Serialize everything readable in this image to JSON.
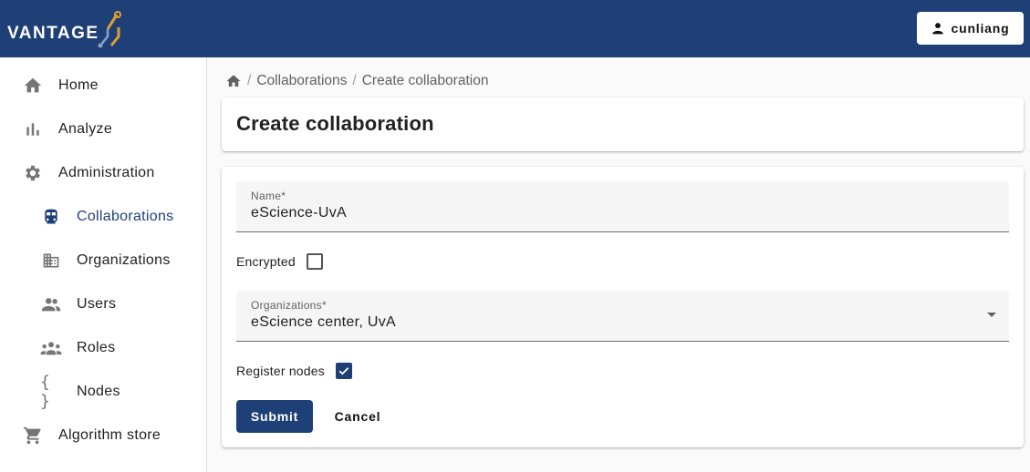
{
  "header": {
    "logo_text": "VANTAGE",
    "user_label": "cunliang",
    "brand_color": "#1e4077",
    "accent_color": "#e0a030"
  },
  "sidebar": {
    "items": [
      {
        "label": "Home",
        "icon": "home-icon"
      },
      {
        "label": "Analyze",
        "icon": "bar-chart-icon"
      },
      {
        "label": "Administration",
        "icon": "gear-icon"
      },
      {
        "label": "Collaborations",
        "icon": "train-icon",
        "active": true
      },
      {
        "label": "Organizations",
        "icon": "building-icon"
      },
      {
        "label": "Users",
        "icon": "people-icon"
      },
      {
        "label": "Roles",
        "icon": "groups-icon"
      },
      {
        "label": "Nodes",
        "icon": "braces-icon"
      },
      {
        "label": "Algorithm store",
        "icon": "cart-icon"
      }
    ]
  },
  "breadcrumb": {
    "items": [
      "Collaborations",
      "Create collaboration"
    ]
  },
  "page": {
    "title": "Create collaboration"
  },
  "form": {
    "name_label": "Name*",
    "name_value": "eScience-UvA",
    "encrypted_label": "Encrypted",
    "encrypted_checked": false,
    "organizations_label": "Organizations*",
    "organizations_value": "eScience center, UvA",
    "register_nodes_label": "Register nodes",
    "register_nodes_checked": true,
    "submit_label": "Submit",
    "cancel_label": "Cancel"
  }
}
